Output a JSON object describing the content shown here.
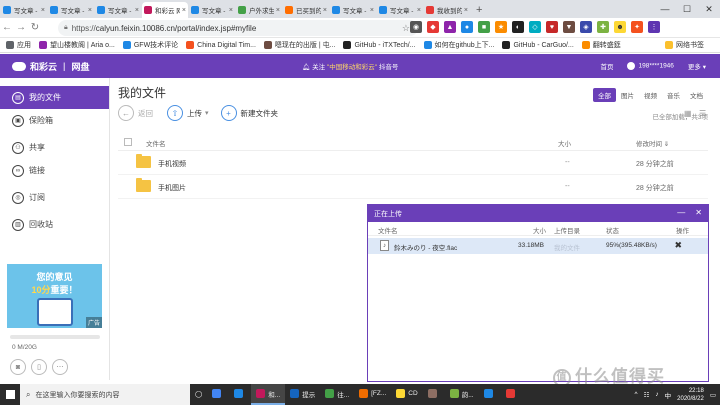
{
  "browser": {
    "tabs": [
      {
        "label": "写文章 - 知",
        "color": "#1e88e5",
        "icon": "zhihu-icon"
      },
      {
        "label": "写文章 - 知",
        "color": "#1e88e5",
        "icon": "zhihu-icon"
      },
      {
        "label": "写文章 - 知",
        "color": "#1e88e5",
        "icon": "zhihu-icon"
      },
      {
        "label": "和彩云 网盘",
        "color": "#c2185b",
        "icon": "hecaiyun-icon"
      },
      {
        "label": "写文章 - 知",
        "color": "#1e88e5",
        "icon": "zhihu-icon"
      },
      {
        "label": "户外求生指",
        "color": "#43a047",
        "icon": "site-icon"
      },
      {
        "label": "已买到的宝",
        "color": "#ff6d00",
        "icon": "taobao-icon"
      },
      {
        "label": "写文章 - 知",
        "color": "#1e88e5",
        "icon": "zhihu-icon"
      },
      {
        "label": "写文章 - 知",
        "color": "#1e88e5",
        "icon": "zhihu-icon"
      },
      {
        "label": "我收到的评",
        "color": "#e53935",
        "icon": "site-icon"
      }
    ],
    "active_tab": 3,
    "new_tab": "+",
    "window_controls": [
      "—",
      "☐",
      "✕"
    ],
    "url_prefix": "https://",
    "url": "calyun.feixin.10086.cn/portal/index.jsp#myfile",
    "bookmarks": [
      {
        "label": "应用",
        "color": "#5f6368"
      },
      {
        "label": "望山楼教阁 | Aria o...",
        "color": "#8e24aa"
      },
      {
        "label": "GFW技术评论",
        "color": "#1e88e5"
      },
      {
        "label": "China Digital Tim...",
        "color": "#f4511e"
      },
      {
        "label": "嗯现在的出版 | 屯...",
        "color": "#6d4c41"
      },
      {
        "label": "GitHub - iTXTech/...",
        "color": "#212121"
      },
      {
        "label": "如何在github上下...",
        "color": "#1e88e5"
      },
      {
        "label": "GitHub - CarGuo/...",
        "color": "#212121"
      },
      {
        "label": "翻转盛筵",
        "color": "#fb8c00"
      }
    ],
    "bookmarks_right": "网络书签"
  },
  "site": {
    "brand": "和彩云",
    "section": "网盘",
    "notice_prefix": "关注",
    "notice_highlight": "\"中国移动和彩云\"",
    "notice_suffix": "抖音号",
    "header_links": [
      "首页",
      "198****1946",
      "更多"
    ],
    "brand_color": "#6a3fb8"
  },
  "sidebar": {
    "items": [
      {
        "label": "我的文件",
        "icon": "folder-icon",
        "active": true
      },
      {
        "label": "保险箱",
        "icon": "safe-icon"
      },
      {
        "label": "共享",
        "icon": "share-icon"
      },
      {
        "label": "链接",
        "icon": "link-icon"
      },
      {
        "label": "订阅",
        "icon": "rss-icon"
      },
      {
        "label": "回收站",
        "icon": "trash-icon"
      }
    ],
    "promo_line1": "您的意见",
    "promo_line2_a": "10分",
    "promo_line2_b": "重要！",
    "promo_ad": "广告",
    "storage": "0 M/20G"
  },
  "main": {
    "title": "我的文件",
    "filters": [
      "全部",
      "图片",
      "视频",
      "音乐",
      "文档"
    ],
    "active_filter": 0,
    "back": "返回",
    "upload": "上传",
    "new_folder": "新建文件夹",
    "summary": "已全部加载，共3项",
    "columns": {
      "name": "文件名",
      "size": "大小",
      "time": "修改时间 ⇓"
    },
    "files": [
      {
        "name": "手机视频",
        "size": "--",
        "time": "28 分钟之前"
      },
      {
        "name": "手机图片",
        "size": "--",
        "time": "28 分钟之前"
      }
    ]
  },
  "upload_panel": {
    "title": "正在上传",
    "columns": {
      "name": "文件名",
      "size": "大小",
      "dir": "上传目录",
      "status": "状态",
      "op": "操作"
    },
    "item": {
      "name": "鈴木みのり - 夜空.flac",
      "size": "33.18MB",
      "dir": "我的文件",
      "status": "95%(395.48KB/s)"
    }
  },
  "taskbar": {
    "search_placeholder": "在这里输入你要搜索的内容",
    "apps": [
      {
        "label": "",
        "color": "#4285f4"
      },
      {
        "label": "",
        "color": "#1e88e5"
      },
      {
        "label": "和...",
        "color": "#c2185b",
        "on": true
      },
      {
        "label": "提示",
        "color": "#1565c0"
      },
      {
        "label": "往...",
        "color": "#43a047"
      },
      {
        "label": "[FZ...",
        "color": "#ef6c00"
      },
      {
        "label": "CD",
        "color": "#fdd835"
      },
      {
        "label": "",
        "color": "#8d6e63"
      },
      {
        "label": "韵...",
        "color": "#7cb342"
      },
      {
        "label": "",
        "color": "#1e88e5"
      },
      {
        "label": "",
        "color": "#e53935"
      }
    ],
    "time": "22:18",
    "date": "2020/8/22"
  },
  "watermark": "什么值得买"
}
